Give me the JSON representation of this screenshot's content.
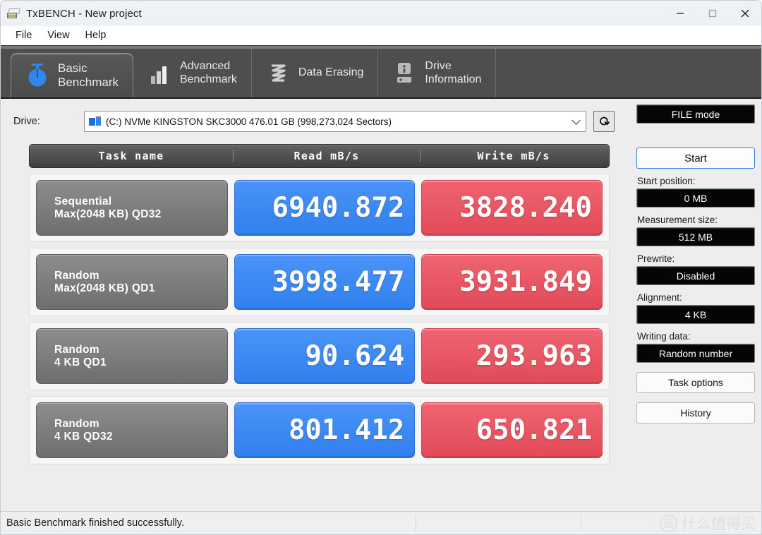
{
  "window": {
    "title": "TxBENCH - New project",
    "app_icon": "drive-app-icon",
    "controls": {
      "minimize": "minimize",
      "maximize": "maximize",
      "close": "close"
    }
  },
  "menubar": {
    "items": [
      {
        "label": "File"
      },
      {
        "label": "View"
      },
      {
        "label": "Help"
      }
    ]
  },
  "tabs": [
    {
      "label": "Basic\nBenchmark",
      "icon": "stopwatch-icon",
      "active": true
    },
    {
      "label": "Advanced\nBenchmark",
      "icon": "bar-chart-icon",
      "active": false
    },
    {
      "label": "Data Erasing",
      "icon": "shred-icon",
      "active": false
    },
    {
      "label": "Drive\nInformation",
      "icon": "drive-info-icon",
      "active": false
    }
  ],
  "drive": {
    "label": "Drive:",
    "selected": "(C:) NVMe KINGSTON SKC3000  476.01 GB (998,273,024 Sectors)",
    "refresh_icon": "refresh-loop-icon",
    "dropdown_icon": "chevron-down-icon"
  },
  "table": {
    "headers": {
      "name": "Task name",
      "read": "Read mB/s",
      "write": "Write mB/s"
    },
    "rows": [
      {
        "title": "Sequential",
        "subtitle": "Max(2048 KB) QD32",
        "read": "6940.872",
        "write": "3828.240"
      },
      {
        "title": "Random",
        "subtitle": "Max(2048 KB) QD1",
        "read": "3998.477",
        "write": "3931.849"
      },
      {
        "title": "Random",
        "subtitle": "4 KB QD1",
        "read": "90.624",
        "write": "293.963"
      },
      {
        "title": "Random",
        "subtitle": "4 KB QD32",
        "read": "801.412",
        "write": "650.821"
      }
    ]
  },
  "sidebar": {
    "mode": "FILE mode",
    "start_button": "Start",
    "fields": [
      {
        "label": "Start position:",
        "value": "0 MB"
      },
      {
        "label": "Measurement size:",
        "value": "512 MB"
      },
      {
        "label": "Prewrite:",
        "value": "Disabled"
      },
      {
        "label": "Alignment:",
        "value": "4 KB"
      },
      {
        "label": "Writing data:",
        "value": "Random number"
      }
    ],
    "task_options_button": "Task options",
    "history_button": "History"
  },
  "statusbar": {
    "message": "Basic Benchmark finished successfully.",
    "segment2": "",
    "segment3": "",
    "watermark_mark": "值",
    "watermark_text": "什么值得买"
  },
  "colors": {
    "read_badge": "#3180ef",
    "write_badge": "#e24a58",
    "tabstrip": "#4e4e4e",
    "background": "#ededed",
    "accent_blue": "#2f7de1"
  }
}
